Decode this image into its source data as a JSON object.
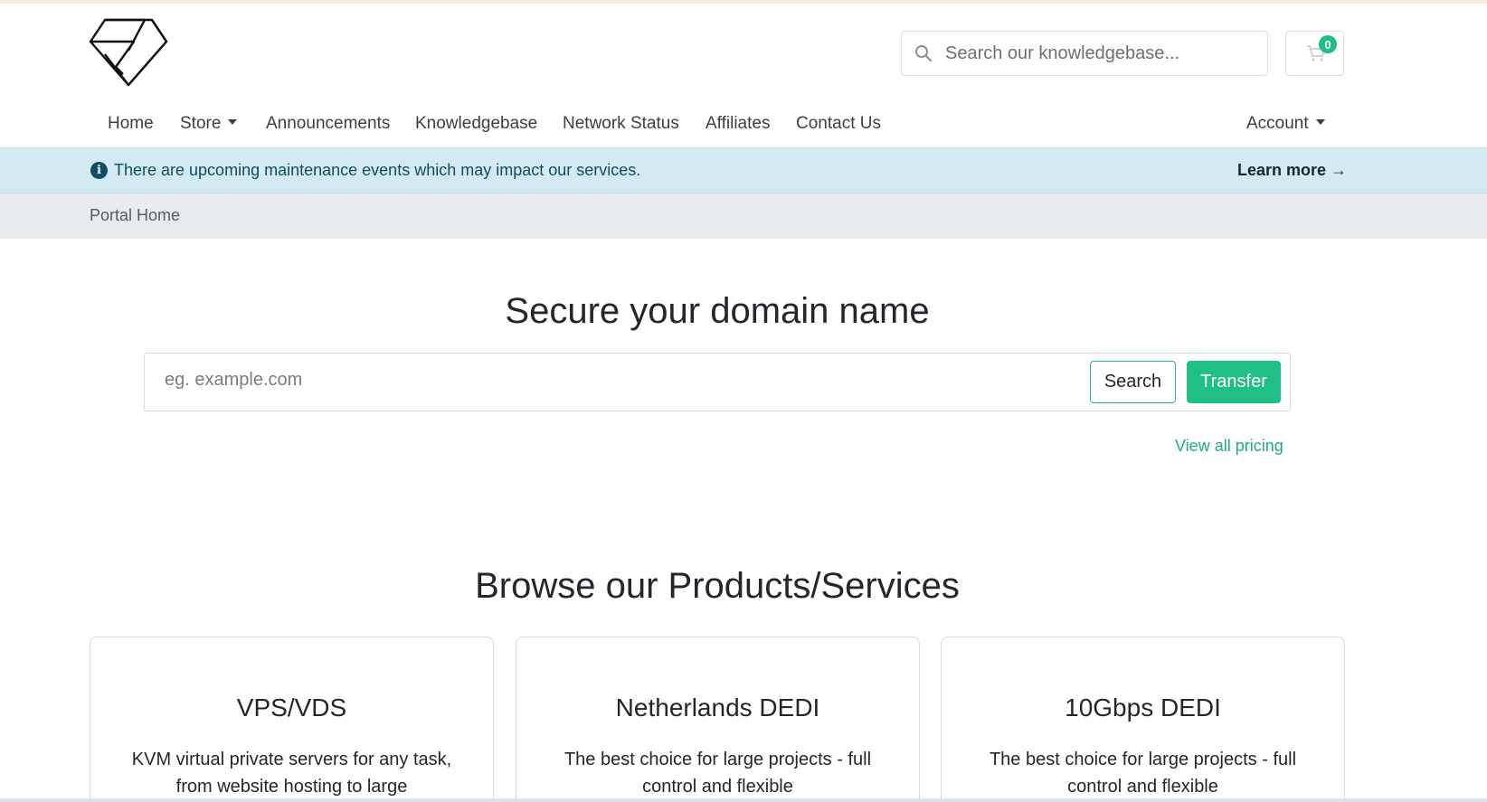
{
  "header": {
    "kb_search_placeholder": "Search our knowledgebase...",
    "cart_count": "0"
  },
  "nav": {
    "items": [
      {
        "label": "Home"
      },
      {
        "label": "Store"
      },
      {
        "label": "Announcements"
      },
      {
        "label": "Knowledgebase"
      },
      {
        "label": "Network Status"
      },
      {
        "label": "Affiliates"
      },
      {
        "label": "Contact Us"
      }
    ],
    "account_label": "Account"
  },
  "alert": {
    "text": "There are upcoming maintenance events which may impact our services.",
    "link_label": "Learn more →"
  },
  "breadcrumb": {
    "label": "Portal Home"
  },
  "domain": {
    "heading": "Secure your domain name",
    "placeholder": "eg. example.com",
    "search_label": "Search",
    "transfer_label": "Transfer",
    "pricing_link": "View all pricing"
  },
  "products": {
    "heading": "Browse our Products/Services",
    "cards": [
      {
        "title": "VPS/VDS",
        "description": "KVM virtual private servers for any task, from website hosting to large"
      },
      {
        "title": "Netherlands DEDI",
        "description": "The best choice for large projects - full control and flexible"
      },
      {
        "title": "10Gbps DEDI",
        "description": "The best choice for large projects - full control and flexible"
      }
    ]
  },
  "colors": {
    "accent": "#1fbf85",
    "alert_bg": "#d4eaf2",
    "alert_text": "#0e4d62",
    "breadcrumb_bg": "#e9ecef"
  }
}
